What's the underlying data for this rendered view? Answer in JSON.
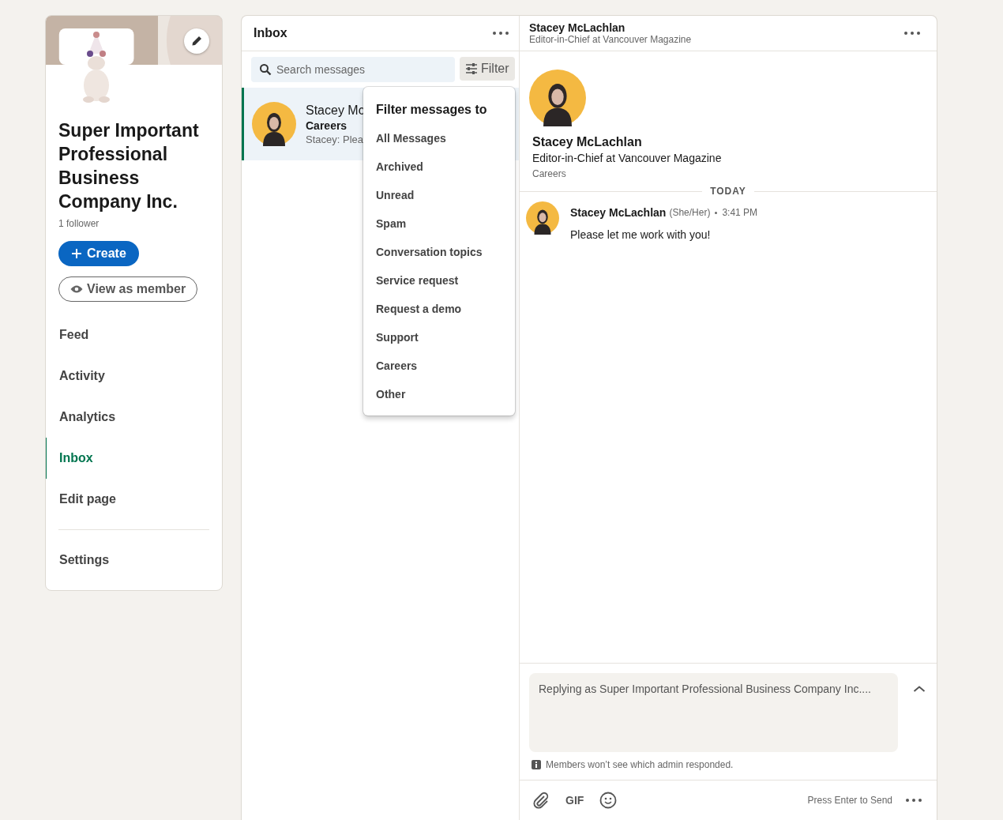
{
  "company": {
    "name": "Super Important Professional Business Company Inc.",
    "followers": "1 follower",
    "create_button": "Create",
    "view_button": "View as member"
  },
  "nav": [
    {
      "label": "Feed",
      "selected": false
    },
    {
      "label": "Activity",
      "selected": false
    },
    {
      "label": "Analytics",
      "selected": false
    },
    {
      "label": "Inbox",
      "selected": true
    },
    {
      "label": "Edit page",
      "selected": false
    }
  ],
  "settings": "Settings",
  "inbox": {
    "title": "Inbox",
    "search": {
      "placeholder": "Search messages"
    },
    "filter_button": "Filter",
    "conversations": [
      {
        "name": "Stacey Mc",
        "topic": "Careers",
        "preview": "Stacey: Plea",
        "selected": true
      }
    ]
  },
  "filter_menu": {
    "title": "Filter messages to",
    "options": [
      "All Messages",
      "Archived",
      "Unread",
      "Spam",
      "Conversation topics",
      "Service request",
      "Request a demo",
      "Support",
      "Careers",
      "Other"
    ]
  },
  "conversation": {
    "name": "Stacey McLachlan",
    "headline": "Editor-in-Chief at Vancouver Magazine",
    "profile": {
      "name": "Stacey McLachlan",
      "headline": "Editor-in-Chief at Vancouver Magazine",
      "topic": "Careers"
    },
    "day": "TODAY",
    "messages": [
      {
        "sender": "Stacey McLachlan",
        "pronouns": "(She/Her)",
        "time": "3:41 PM",
        "text": "Please let me work with you!"
      }
    ],
    "reply": {
      "placeholder": "Replying as Super Important Professional Business Company Inc....",
      "note": "Members won’t see which admin responded.",
      "gif": "GIF",
      "send_hint": "Press Enter to Send"
    }
  }
}
